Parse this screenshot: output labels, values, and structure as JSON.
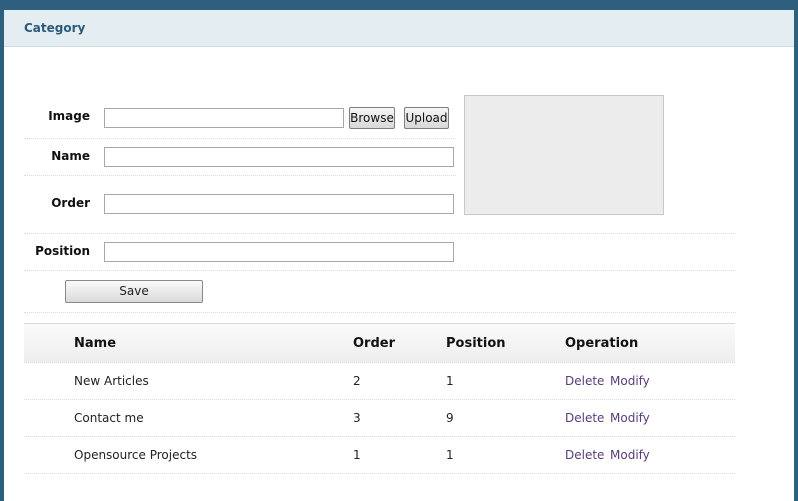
{
  "panel": {
    "title": "Category"
  },
  "form": {
    "image_label": "Image",
    "image_value": "",
    "browse_label": "Browse",
    "upload_label": "Upload",
    "name_label": "Name",
    "name_value": "",
    "order_label": "Order",
    "order_value": "",
    "position_label": "Position",
    "position_value": "",
    "save_label": "Save"
  },
  "table": {
    "headers": {
      "name": "Name",
      "order": "Order",
      "position": "Position",
      "operation": "Operation"
    },
    "rows": [
      {
        "name": "New Articles",
        "order": "2",
        "position": "1",
        "delete": "Delete",
        "modify": "Modify"
      },
      {
        "name": "Contact me",
        "order": "3",
        "position": "9",
        "delete": "Delete",
        "modify": "Modify"
      },
      {
        "name": "Opensource Projects",
        "order": "1",
        "position": "1",
        "delete": "Delete",
        "modify": "Modify"
      }
    ]
  }
}
